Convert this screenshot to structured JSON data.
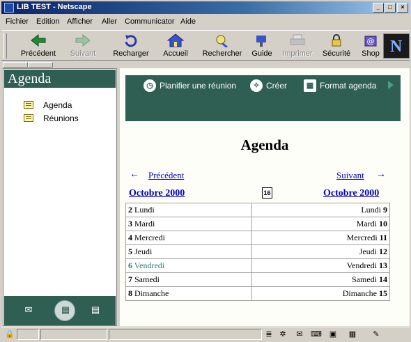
{
  "window": {
    "title": "LIB TEST - Netscape"
  },
  "menu": [
    "Fichier",
    "Edition",
    "Afficher",
    "Aller",
    "Communicator",
    "Aide"
  ],
  "toolbar": {
    "back": "Précédent",
    "forward": "Suivant",
    "reload": "Recharger",
    "home": "Accueil",
    "search": "Rechercher",
    "guide": "Guide",
    "print": "Imprimer",
    "security": "Sécurité",
    "shop": "Shop"
  },
  "sidebar": {
    "title": "Agenda",
    "items": [
      {
        "label": "Agenda"
      },
      {
        "label": "Réunions"
      }
    ]
  },
  "banner": {
    "plan_meeting": "Planifier une réunion",
    "create": "Créer",
    "agenda_format": "Format agenda"
  },
  "page": {
    "heading": "Agenda",
    "prev_label": "Précédent",
    "next_label": "Suivant",
    "month_left": "Octobre 2000",
    "month_right": "Octobre 2000",
    "calendar_day": "16"
  },
  "week": {
    "left": [
      {
        "num": "2",
        "day": "Lundi"
      },
      {
        "num": "3",
        "day": "Mardi"
      },
      {
        "num": "4",
        "day": "Mercredi"
      },
      {
        "num": "5",
        "day": "Jeudi"
      },
      {
        "num": "6",
        "day": "Vendredi"
      },
      {
        "num": "7",
        "day": "Samedi"
      },
      {
        "num": "8",
        "day": "Dimanche"
      }
    ],
    "right": [
      {
        "num": "9",
        "day": "Lundi"
      },
      {
        "num": "10",
        "day": "Mardi"
      },
      {
        "num": "11",
        "day": "Mercredi"
      },
      {
        "num": "12",
        "day": "Jeudi"
      },
      {
        "num": "13",
        "day": "Vendredi"
      },
      {
        "num": "14",
        "day": "Samedi"
      },
      {
        "num": "15",
        "day": "Dimanche"
      }
    ]
  },
  "colors": {
    "accent": "#2f5e52",
    "today": "#237f76",
    "link": "#0000cc"
  }
}
